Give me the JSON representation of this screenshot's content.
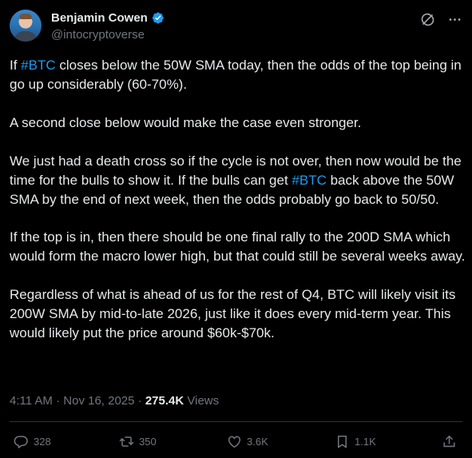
{
  "author": {
    "display_name": "Benjamin Cowen",
    "handle": "@intocryptoverse"
  },
  "tweet": {
    "paragraphs": [
      [
        {
          "text": "If "
        },
        {
          "text": "#BTC",
          "hashtag": true
        },
        {
          "text": " closes below the 50W SMA today, then the odds of the top being in go up considerably (60-70%)."
        }
      ],
      [
        {
          "text": "A second close below would make the case even stronger."
        }
      ],
      [
        {
          "text": "We just had a death cross so if the cycle is not over, then now would be the time for the bulls to show it. If the bulls can get "
        },
        {
          "text": "#BTC",
          "hashtag": true
        },
        {
          "text": " back above the 50W SMA by the end of next week, then the odds probably go back to 50/50."
        }
      ],
      [
        {
          "text": "If the top is in, then there should be one final rally to the 200D SMA which would form the macro lower high, but that could still be several weeks away."
        }
      ],
      [
        {
          "text": "Regardless of what is ahead of us for the rest of Q4, BTC will likely visit its 200W SMA by mid-to-late 2026, just like it does every mid-term year. This would likely put the price around $60k-$70k."
        }
      ]
    ]
  },
  "meta": {
    "time": "4:11 AM",
    "separator": "·",
    "date": "Nov 16, 2025",
    "separator2": "·",
    "views_count": "275.4K",
    "views_label": "Views"
  },
  "actions": {
    "replies": "328",
    "reposts": "350",
    "likes": "3.6K",
    "bookmarks": "1.1K"
  },
  "icons": {
    "verified": "verified-badge-icon",
    "grok": "grok-icon",
    "more": "more-icon",
    "reply": "reply-icon",
    "repost": "repost-icon",
    "like": "heart-icon",
    "bookmark": "bookmark-icon",
    "share": "share-icon"
  },
  "colors": {
    "background": "#000000",
    "text": "#e7e9ea",
    "secondary": "#71767b",
    "link": "#1d9bf0",
    "divider": "#2f3336"
  }
}
